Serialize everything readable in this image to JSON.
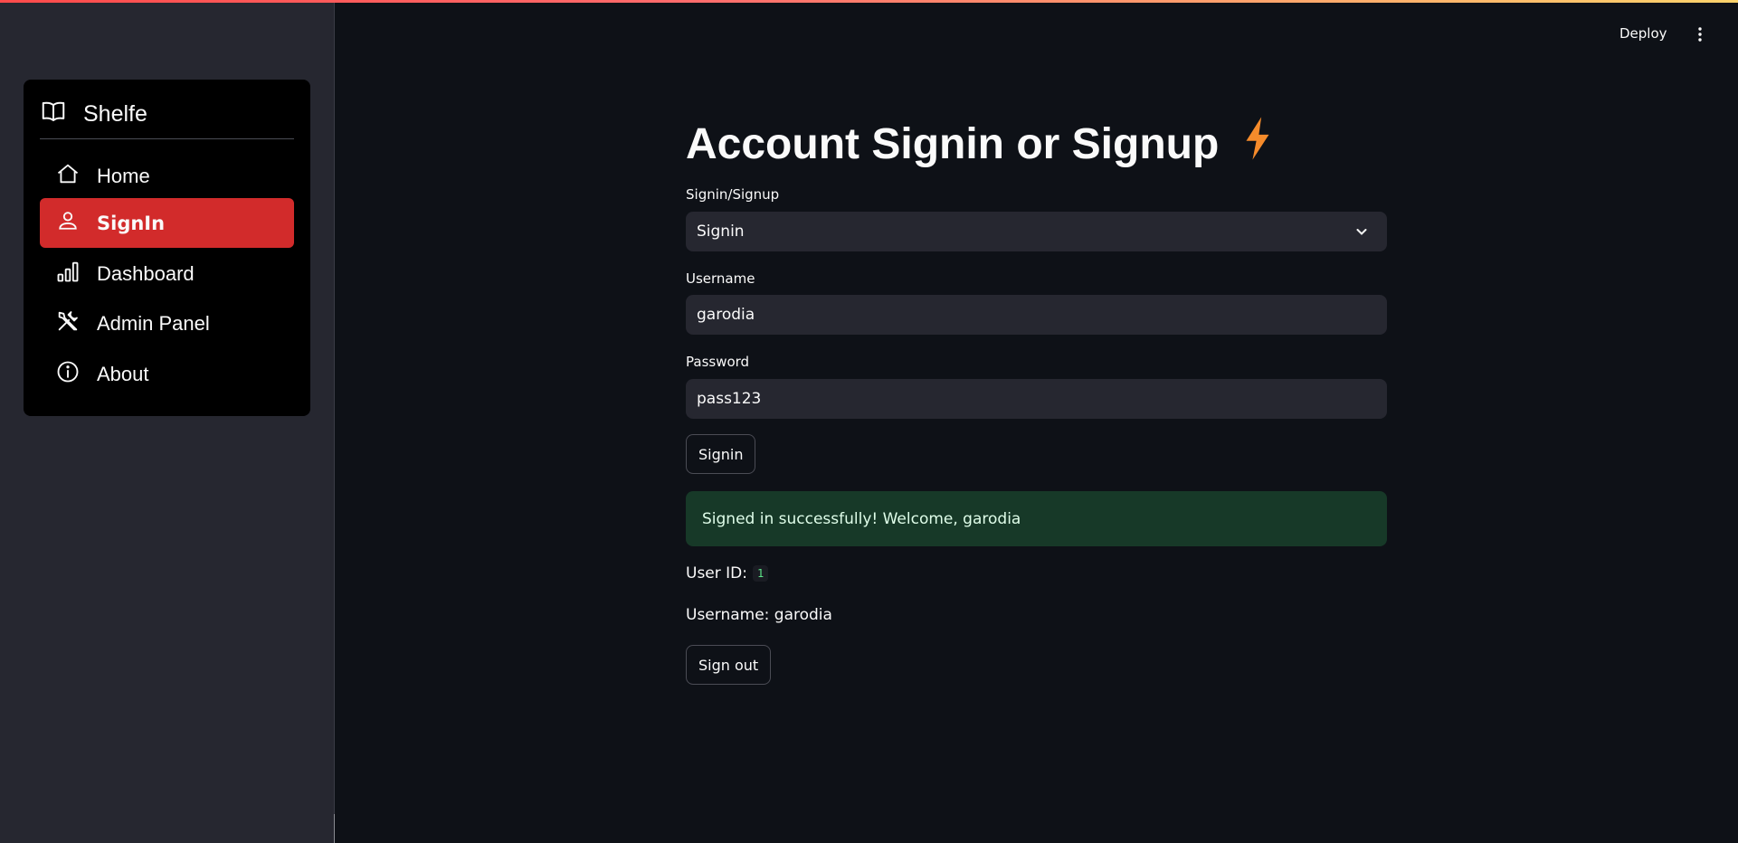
{
  "header": {
    "deploy_label": "Deploy",
    "menu_icon": "vertical-ellipsis-icon"
  },
  "sidebar": {
    "brand": {
      "label": "Shelfe",
      "icon": "book-open-icon"
    },
    "items": [
      {
        "label": "Home",
        "icon": "house-icon",
        "active": false
      },
      {
        "label": "SignIn",
        "icon": "person-icon",
        "active": true
      },
      {
        "label": "Dashboard",
        "icon": "bar-chart-icon",
        "active": false
      },
      {
        "label": "Admin Panel",
        "icon": "tools-icon",
        "active": false
      },
      {
        "label": "About",
        "icon": "info-circle-icon",
        "active": false
      }
    ],
    "active_color": "#d22b2b"
  },
  "main": {
    "title": "Account Signin or Signup",
    "title_icon": "lightning-icon",
    "mode_field": {
      "label": "Signin/Signup",
      "value": "Signin"
    },
    "username_field": {
      "label": "Username",
      "value": "garodia"
    },
    "password_field": {
      "label": "Password",
      "value": "pass123"
    },
    "signin_button": "Signin",
    "success_message": "Signed in successfully! Welcome, garodia",
    "user_id_label": "User ID:",
    "user_id_value": "1",
    "username_line": "Username: garodia",
    "signout_button": "Sign out"
  },
  "colors": {
    "background": "#0e1117",
    "sidebar": "#262730",
    "success_bg": "#173928",
    "accent_icon": "#f58b2b"
  }
}
